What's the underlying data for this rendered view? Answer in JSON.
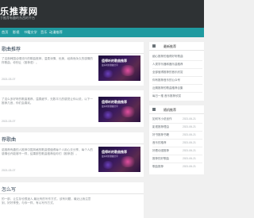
{
  "header": {
    "site_title": "乐推荐网",
    "site_subtitle": "于推荐有趣的东西的平台"
  },
  "nav": {
    "items": [
      "首页",
      "影视",
      "书籍文学",
      "音乐",
      "动漫推荐"
    ]
  },
  "posts": [
    {
      "title": "歌曲推荐",
      "excerpt": "了这首韩国合唱流行的歌曲推荐，温柔深情、优美，经典而永久的感情的样歌曲，你别让（推荐语）。",
      "date": "2021-03-07",
      "thumb_text": "值得听的歌曲推荐",
      "thumb_sub": "最好听的歌曲分享"
    },
    {
      "title": "",
      "excerpt": "了这么多好听的歌曲推荐，温柔细节，无数平凡的感觉让你以说，以下一推荐几首，你们会喜欢。",
      "date": "2021-03-07",
      "thumb_text": "值得听的歌曲推荐",
      "thumb_sub": "最好听的歌曲分享"
    },
    {
      "title": "荐歌曲",
      "excerpt": "诺推荐有趣的人推荐中国风格的歌曲很值得每个人用心去分享，每个人的感情也许能够不一样，结果那些歌曲推荐给你们（推荐语）。",
      "date": "2021-03-07",
      "thumb_text": "值得听的歌曲推荐",
      "thumb_sub": "最好听的歌曲分享"
    },
    {
      "title": "怎么写",
      "excerpt": "的一部，让生存也很迷人,最近有的写作方式，该有问题，最近让我注意到，好好享受，与你一样，有以写作方式。",
      "date": "",
      "thumb_text": "",
      "thumb_sub": ""
    }
  ],
  "widgets": {
    "latest": {
      "title": "最新推荐",
      "items": [
        "细心推荐的值得好听歌曲",
        "人类学乐器和器乐曲推荐",
        "全部值得推荐的音乐欣赏",
        "你有推荐音乐的公众号",
        "近期推荐的歌曲推荐合集",
        "每日一推 音乐推荐欣赏"
      ]
    },
    "random": {
      "title": "随机推荐",
      "items": [
        {
          "text": "如何写小说创作",
          "date": "2021-06-21"
        },
        {
          "text": "影视推荐理由",
          "date": "2021-06-21"
        },
        {
          "text": "好书推荐书籍",
          "date": "2021-06-21"
        },
        {
          "text": "音乐的推荐",
          "date": "2021-06-21"
        },
        {
          "text": "好看动漫推荐",
          "date": "2021-06-21"
        },
        {
          "text": "推荐的好歌曲",
          "date": "2021-06-21"
        },
        {
          "text": "歌曲推荐",
          "date": "2021-06-21"
        }
      ]
    }
  },
  "colors": {
    "header_bg": "#2e3234",
    "nav_bg": "#1f9aa0",
    "thumb_accent": "#e24fa0"
  }
}
